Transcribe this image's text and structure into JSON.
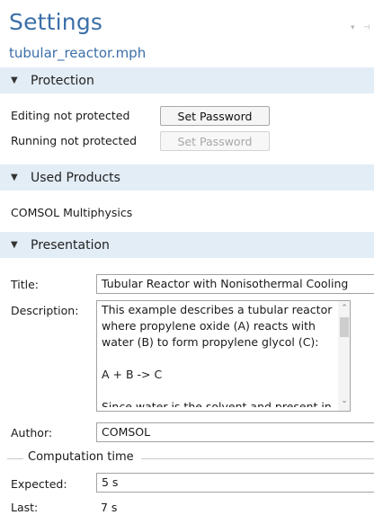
{
  "header": {
    "title": "Settings",
    "filename": "tubular_reactor.mph",
    "window_controls": [
      "▾",
      "⊣"
    ]
  },
  "protection": {
    "heading": "Protection",
    "editing_status": "Editing not protected",
    "editing_button": "Set Password",
    "running_status": "Running not protected",
    "running_button": "Set Password"
  },
  "used_products": {
    "heading": "Used Products",
    "product": "COMSOL Multiphysics"
  },
  "presentation": {
    "heading": "Presentation",
    "title_label": "Title:",
    "title_value": "Tubular Reactor with Nonisothermal Cooling",
    "description_label": "Description:",
    "description_lines": [
      "This example describes a tubular reactor",
      "where propylene oxide (A) reacts with",
      "water (B) to form propylene glycol (C):",
      "",
      "A + B -> C",
      "",
      "Since water is the solvent and present in"
    ],
    "author_label": "Author:",
    "author_value": "COMSOL"
  },
  "computation_time": {
    "heading": "Computation time",
    "expected_label": "Expected:",
    "expected_value": "5 s",
    "last_label": "Last:",
    "last_value": "7 s"
  },
  "icons": {
    "section_toggle": "▼",
    "scroll_up": "⌃",
    "scroll_down": "⌄"
  },
  "colors": {
    "accent": "#3b6fa8",
    "section_bg": "#e3edf6",
    "field_border": "#a3a3a3"
  }
}
